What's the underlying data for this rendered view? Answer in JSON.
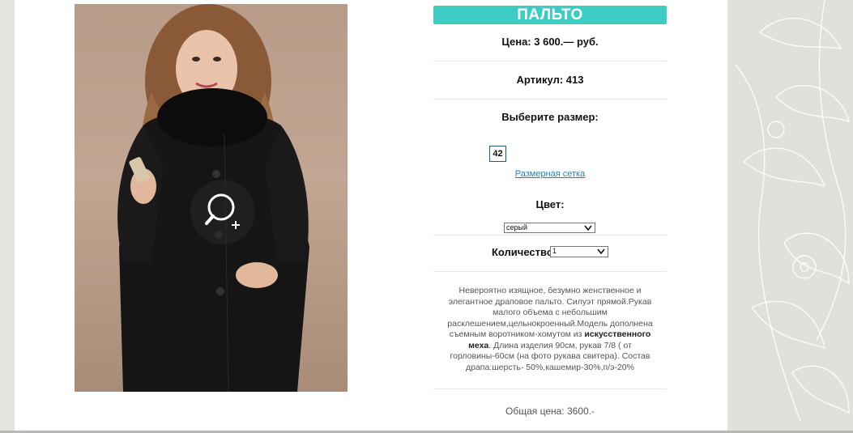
{
  "product": {
    "title": "ПАЛЬТО",
    "price": "Цена: 3 600.— руб.",
    "article": "Артикул: 413",
    "choose_size_label": "Выберите размер:",
    "sizes": [
      "42"
    ],
    "size_chart_link": "Размерная сетка",
    "color_label": "Цвет:",
    "color_selected": "серый",
    "quantity_label": "Количество:",
    "quantity_selected": "1",
    "description": {
      "part1": "Невероятно изящное, безумно женственное и элегантное драповое пальто. Силуэт прямой.Рукав малого объема с небольшим расклешением,цельнокроенный.Модель дополнена съемным воротником-хомутом из",
      "bold": "искусственного меха",
      "part2": ". Длина изделия 90см, рукав 7/8 ( от горловины-60см (на фото рукава свитера). Состав драпа:шерсть- 50%,кашемир-30%,п/э-20%"
    },
    "total": "Общая цена: 3600.-"
  },
  "icons": {
    "zoom": "zoom-in-icon",
    "select_arrow": "chevron-down-icon"
  },
  "colors": {
    "accent": "#3cccc4",
    "link": "#2a7fb0",
    "size_border": "#1e5e78"
  }
}
